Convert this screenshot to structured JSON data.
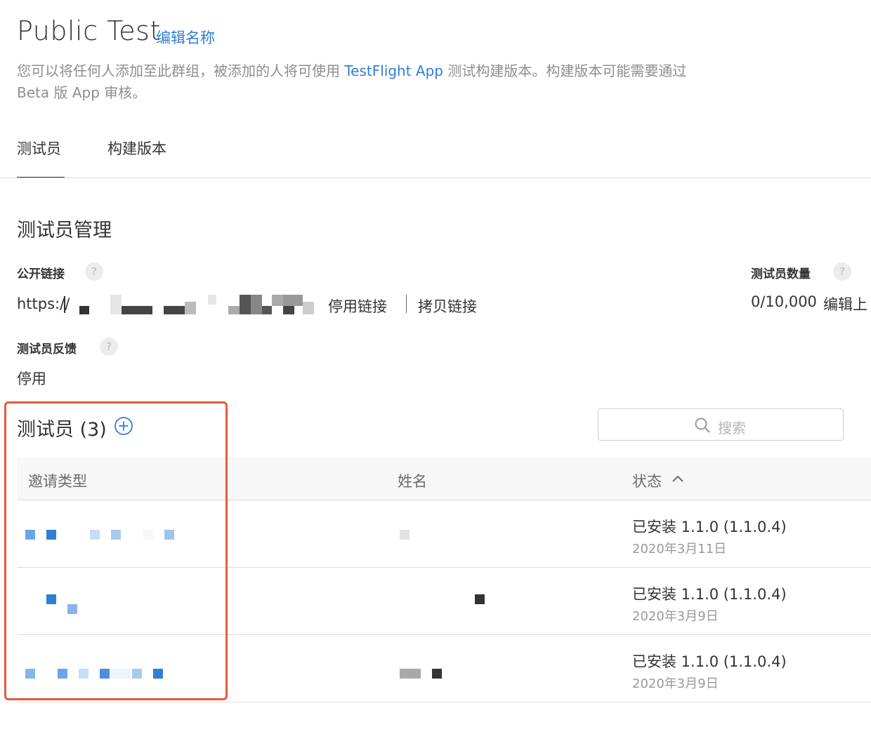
{
  "header": {
    "title": "Public Test",
    "edit_name": "编辑名称",
    "desc_part1": "您可以将任何人添加至此群组，被添加的人将可使用 ",
    "desc_link": "TestFlight App",
    "desc_part2": " 测试构建版本。构建版本可能需要通过",
    "desc_line2": "Beta 版 App 审核。"
  },
  "tabs": [
    {
      "label": "测试员",
      "active": true
    },
    {
      "label": "构建版本",
      "active": false
    }
  ],
  "management": {
    "title": "测试员管理",
    "public_link_label": "公开链接",
    "public_link_value": "https://",
    "disable_link": "停用链接",
    "copy_link": "拷贝链接",
    "tester_count_label": "测试员数量",
    "tester_count_value": "0/10,000",
    "edit_limit": "编辑上",
    "feedback_label": "测试员反馈",
    "feedback_action": "停用",
    "help_glyph": "?"
  },
  "testers": {
    "title": "测试员 (3)",
    "search_placeholder": "搜索",
    "columns": [
      "邀请类型",
      "姓名",
      "状态"
    ],
    "rows": [
      {
        "status": "已安装 1.1.0 (1.1.0.4)",
        "date": "2020年3月11日"
      },
      {
        "status": "已安装 1.1.0 (1.1.0.4)",
        "date": "2020年3月9日"
      },
      {
        "status": "已安装 1.1.0 (1.1.0.4)",
        "date": "2020年3月9日"
      }
    ]
  },
  "colors": {
    "accent": "#2f7fd6",
    "highlight_border": "#e55b3c"
  }
}
